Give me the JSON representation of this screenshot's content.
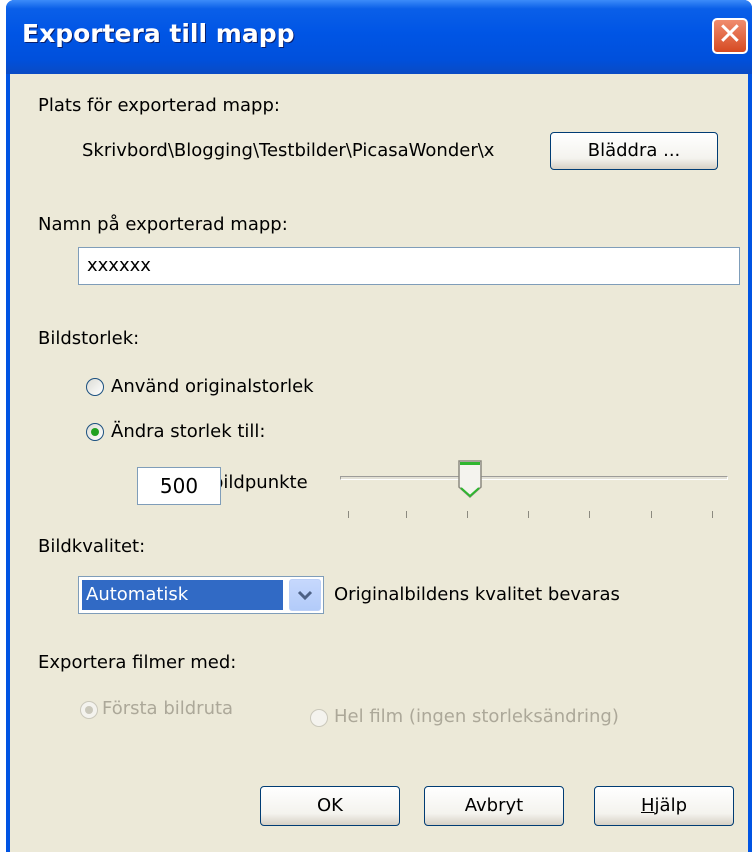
{
  "dialog": {
    "title": "Exportera till mapp",
    "close_symbol": "✕"
  },
  "location": {
    "label": "Plats för exporterad mapp:",
    "path": "Skrivbord\\Blogging\\Testbilder\\PicasaWonder\\x",
    "browse_label": "Bläddra ..."
  },
  "folder_name": {
    "label": "Namn på exporterad mapp:",
    "value": "xxxxxx"
  },
  "image_size": {
    "label": "Bildstorlek:",
    "option_original": "Använd originalstorlek",
    "option_resize": "Ändra storlek till:",
    "selected": "resize",
    "size_value": "500",
    "unit": "bildpunkte",
    "slider_fraction": 0.36
  },
  "image_quality": {
    "label": "Bildkvalitet:",
    "selected": "Automatisk",
    "description": "Originalbildens kvalitet bevaras"
  },
  "video_export": {
    "label": "Exportera filmer med:",
    "option_first_frame": "Första bildruta",
    "option_full_movie": "Hel film (ingen storleksändring)",
    "selected": "first_frame",
    "enabled": false
  },
  "buttons": {
    "ok": "OK",
    "cancel": "Avbryt",
    "help_accel": "H",
    "help_rest": "jälp"
  },
  "colors": {
    "titlebar": "#0054e3",
    "client": "#ece9d8",
    "selection": "#316ac5",
    "radio_dot": "#21a121"
  }
}
